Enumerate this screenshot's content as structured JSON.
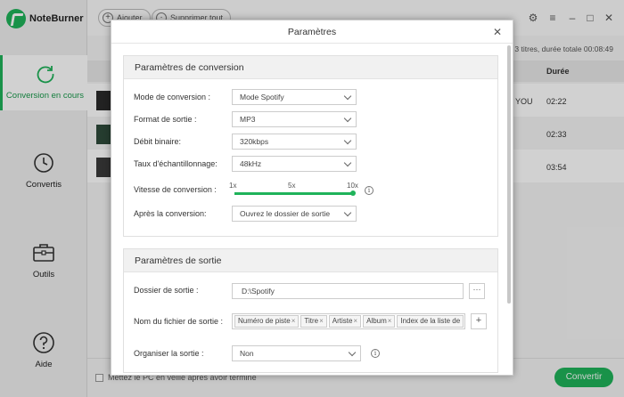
{
  "app": {
    "name": "NoteBurner"
  },
  "sidebar": {
    "items": [
      {
        "label": "Conversion en cours",
        "icon": "refresh-icon"
      },
      {
        "label": "Convertis",
        "icon": "clock-icon"
      },
      {
        "label": "Outils",
        "icon": "toolbox-icon"
      },
      {
        "label": "Aide",
        "icon": "help-icon"
      }
    ]
  },
  "toolbar": {
    "add_label": "Ajouter",
    "delete_all_label": "Supprimer tout"
  },
  "list": {
    "summary": "3 titres, durée totale 00:08:49",
    "duration_header": "Durée",
    "rows": [
      {
        "trail": "YOU",
        "duration": "02:22"
      },
      {
        "trail": "",
        "duration": "02:33"
      },
      {
        "trail": "",
        "duration": "03:54"
      }
    ]
  },
  "bottom": {
    "sleep_label": "Mettez le PC en veille après avoir terminé",
    "convert_label": "Convertir"
  },
  "dialog": {
    "title": "Paramètres",
    "conversion": {
      "heading": "Paramètres de conversion",
      "mode_label": "Mode de conversion :",
      "mode_value": "Mode Spotify",
      "format_label": "Format de sortie :",
      "format_value": "MP3",
      "bitrate_label": "Débit binaire:",
      "bitrate_value": "320kbps",
      "samplerate_label": "Taux d'échantillonnage:",
      "samplerate_value": "48kHz",
      "speed_label": "Vitesse de conversion :",
      "speed_ticks": [
        "1x",
        "5x",
        "10x"
      ],
      "speed_value": "10x",
      "after_label": "Après la conversion:",
      "after_value": "Ouvrez le dossier de sortie"
    },
    "output": {
      "heading": "Paramètres de sortie",
      "folder_label": "Dossier de sortie :",
      "folder_value": "D:\\Spotify",
      "folder_button": "···",
      "filename_label": "Nom du fichier de sortie :",
      "filename_tags": [
        "Numéro de piste",
        "Titre",
        "Artiste",
        "Album",
        "Index de la liste de"
      ],
      "add_tag_button": "+",
      "organize_label": "Organiser la sortie :",
      "organize_value": "Non"
    }
  },
  "colors": {
    "accent": "#1fb35a"
  }
}
